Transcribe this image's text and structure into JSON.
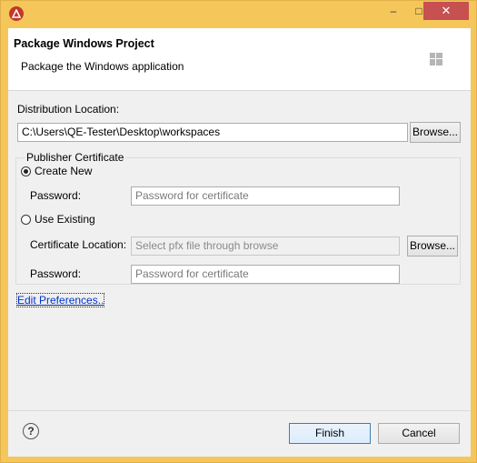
{
  "window": {
    "title": "",
    "controls": {
      "minimize": "–",
      "maximize": "□",
      "close": "✕"
    }
  },
  "header": {
    "title": "Package Windows Project",
    "description": "Package the Windows application",
    "logo_icon": "windows-logo-icon"
  },
  "distribution": {
    "label": "Distribution Location:",
    "value": "C:\\Users\\QE-Tester\\Desktop\\workspaces",
    "browse_label": "Browse..."
  },
  "publisher": {
    "group_label": "Publisher Certificate",
    "create_new": {
      "label": "Create New",
      "selected": true,
      "password_label": "Password:",
      "password_placeholder": "Password for certificate"
    },
    "use_existing": {
      "label": "Use Existing",
      "selected": false,
      "location_label": "Certificate Location:",
      "location_placeholder": "Select pfx file through browse",
      "browse_label": "Browse...",
      "password_label": "Password:",
      "password_placeholder": "Password for certificate"
    }
  },
  "preferences_link": "Edit Preferences..",
  "footer": {
    "help_icon": "help-icon",
    "help_glyph": "?",
    "finish_label": "Finish",
    "cancel_label": "Cancel"
  },
  "colors": {
    "titlebar": "#f5c75a",
    "close_button": "#c75050",
    "link": "#0033cc"
  }
}
